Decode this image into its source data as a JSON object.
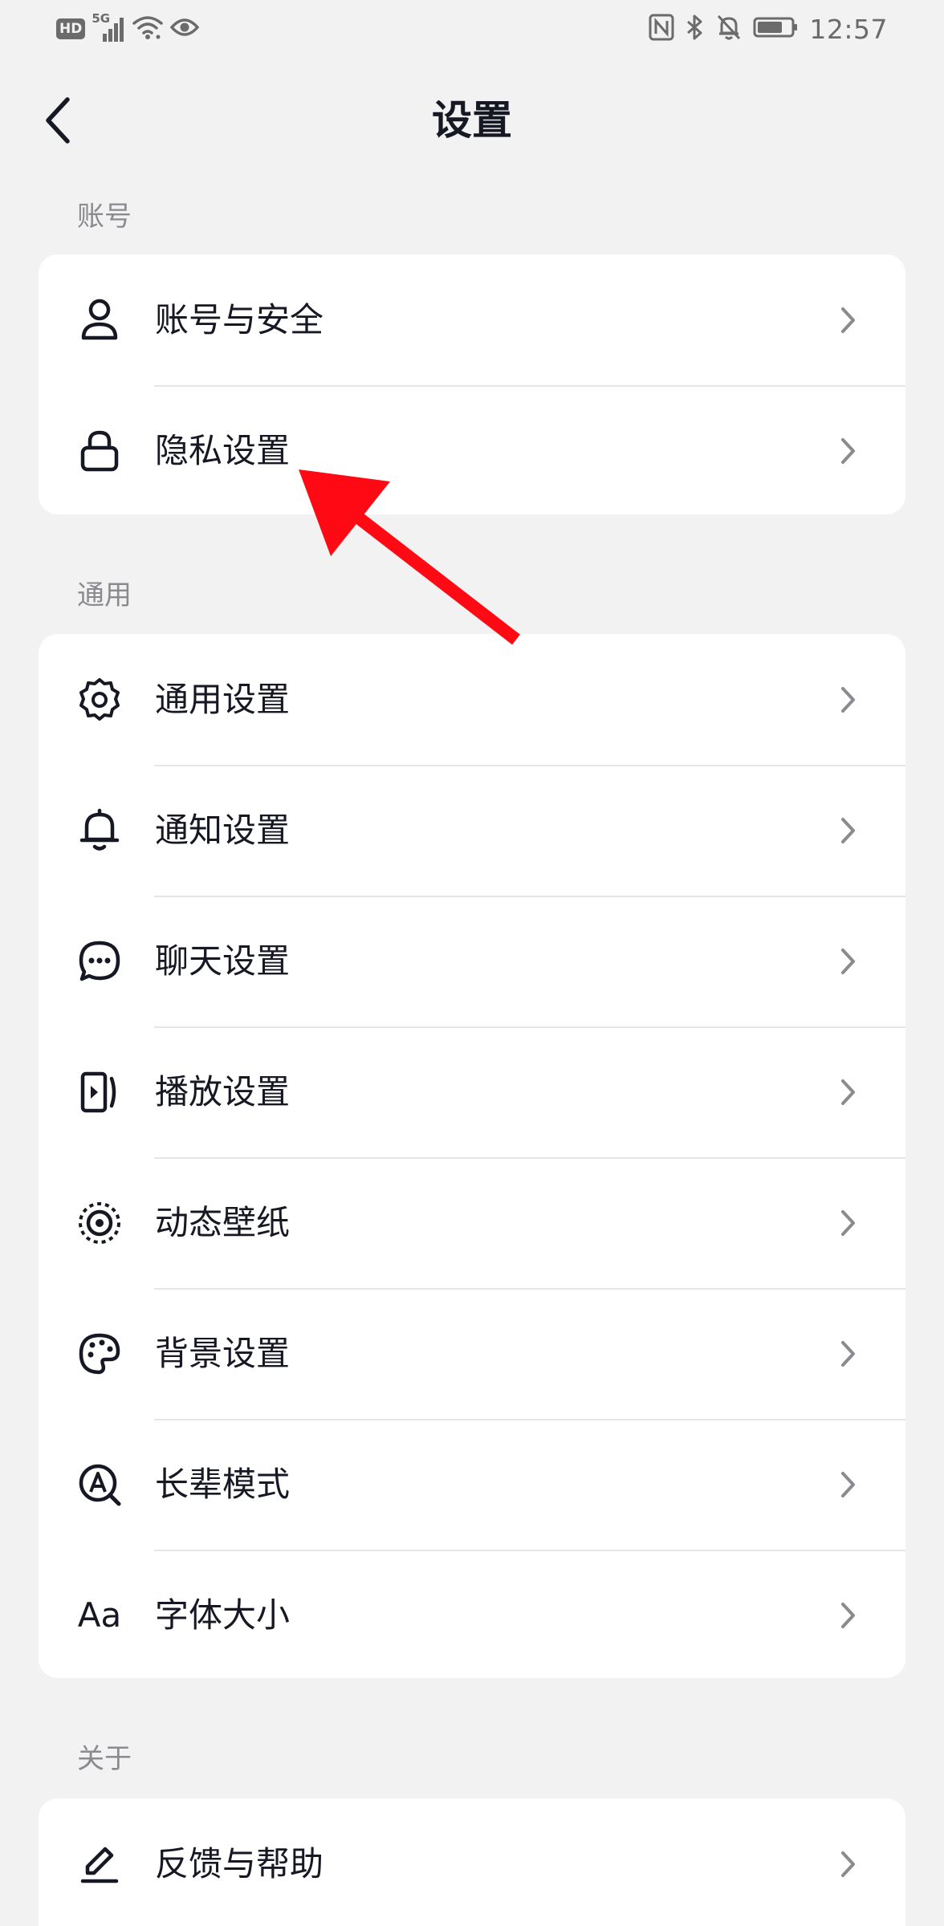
{
  "status_bar": {
    "hd": "HD",
    "network": "5G",
    "time": "12:57"
  },
  "header": {
    "title": "设置",
    "back_icon": "back-chevron-icon"
  },
  "sections": [
    {
      "label": "账号",
      "items": [
        {
          "label": "账号与安全",
          "icon": "user-icon"
        },
        {
          "label": "隐私设置",
          "icon": "lock-icon"
        }
      ]
    },
    {
      "label": "通用",
      "items": [
        {
          "label": "通用设置",
          "icon": "gear-icon"
        },
        {
          "label": "通知设置",
          "icon": "bell-icon"
        },
        {
          "label": "聊天设置",
          "icon": "chat-bubble-icon"
        },
        {
          "label": "播放设置",
          "icon": "play-screen-icon"
        },
        {
          "label": "动态壁纸",
          "icon": "dynamic-wallpaper-icon"
        },
        {
          "label": "背景设置",
          "icon": "palette-icon"
        },
        {
          "label": "长辈模式",
          "icon": "elder-mode-icon"
        },
        {
          "label": "字体大小",
          "icon": "font-size-icon",
          "glyph": "Aa"
        }
      ]
    },
    {
      "label": "关于",
      "items": [
        {
          "label": "反馈与帮助",
          "icon": "edit-pen-icon"
        }
      ]
    }
  ],
  "colors": {
    "background": "#f2f2f2",
    "card": "#ffffff",
    "text": "#161823",
    "section_label": "#8a8a8f",
    "chevron": "#8a8a8f",
    "annotation_arrow": "#ff0a14"
  }
}
